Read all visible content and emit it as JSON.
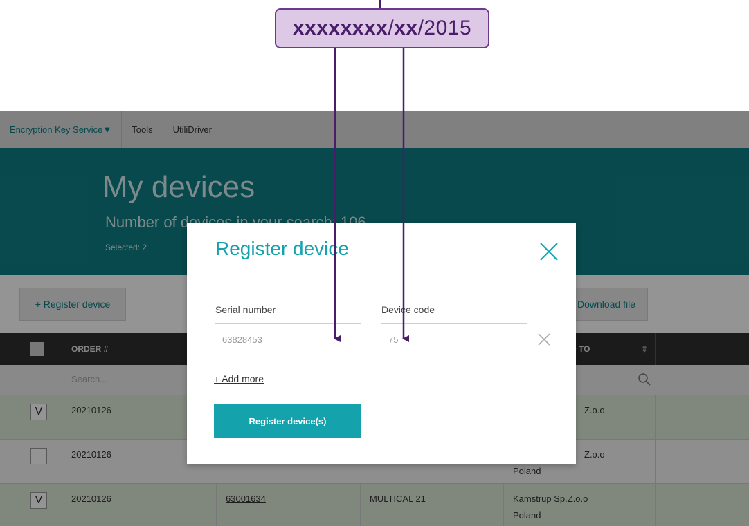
{
  "callout": {
    "part1": "xxxxxxxx",
    "sep1": "/",
    "part2": "xx",
    "part3": "/2015"
  },
  "nav": {
    "items": [
      "Encryption Key Service▼",
      "Tools",
      "UtiliDriver"
    ]
  },
  "banner": {
    "title": "My devices",
    "count_text": "Number of devices in your search: 106",
    "selected_text": "Selected: 2"
  },
  "toolbar": {
    "register_label": "+ Register device",
    "download_label": "Download file"
  },
  "table": {
    "headers": [
      "ORDER #",
      "D TO"
    ],
    "search_placeholder": "Search...",
    "rows": [
      {
        "checked": "V",
        "order": "20210126",
        "serial": "",
        "type": "",
        "owner": "Z.o.o",
        "country": ""
      },
      {
        "checked": "",
        "order": "20210126",
        "serial": "",
        "type": "",
        "owner": "Z.o.o",
        "country": "Poland"
      },
      {
        "checked": "V",
        "order": "20210126",
        "serial": "63001634",
        "type": "MULTICAL 21",
        "owner": "Kamstrup Sp.Z.o.o",
        "country": "Poland"
      }
    ]
  },
  "modal": {
    "title": "Register device",
    "serial_label": "Serial number",
    "serial_value": "63828453",
    "code_label": "Device code",
    "code_value": "75",
    "add_more": "+ Add more",
    "submit": "Register device(s)"
  },
  "colors": {
    "accent": "#14a3ad",
    "banner": "#0d7f84",
    "callout_fill": "#ddc8e6",
    "callout_stroke": "#6b3a8c",
    "arrow": "#4a1d6b"
  }
}
